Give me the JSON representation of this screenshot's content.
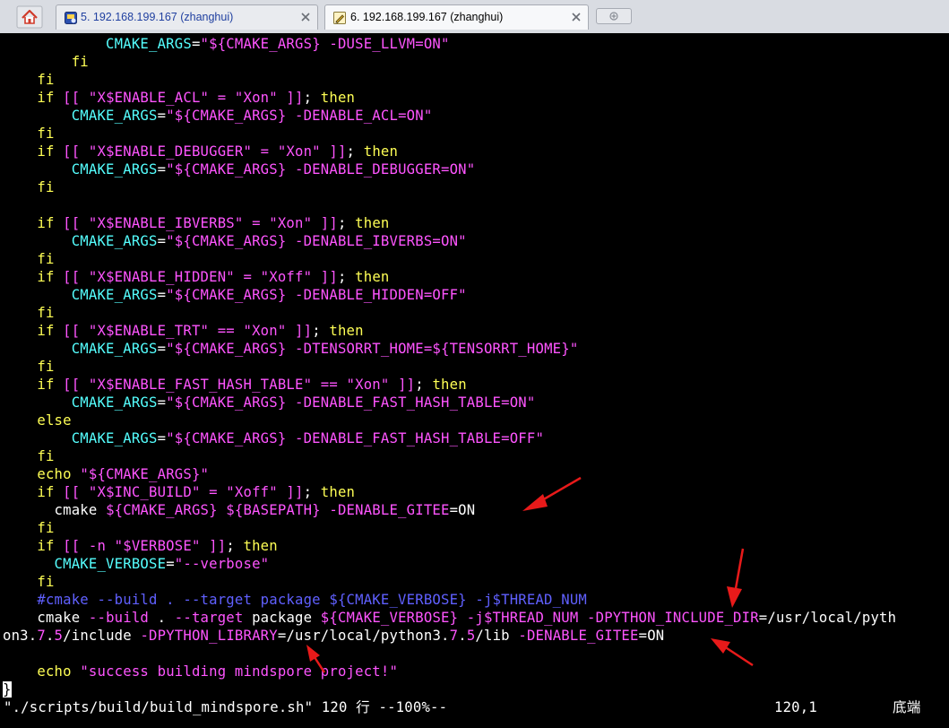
{
  "tabs": [
    {
      "label": "5. 192.168.199.167 (zhanghui)",
      "active": false,
      "icon": "session-icon"
    },
    {
      "label": "6. 192.168.199.167 (zhanghui)",
      "active": true,
      "icon": "pencil-icon"
    }
  ],
  "terminal": {
    "lines": [
      [
        [
          "c",
          "            CMAKE_ARGS"
        ],
        [
          "w",
          "="
        ],
        [
          "s",
          "\"${CMAKE_ARGS} -DUSE_LLVM=ON\""
        ]
      ],
      [
        [
          "k",
          "        fi"
        ]
      ],
      [
        [
          "k",
          "    fi"
        ]
      ],
      [
        [
          "k",
          "    if"
        ],
        [
          "w",
          " "
        ],
        [
          "s",
          "[[ \"X$ENABLE_ACL\" = \"Xon\" ]]"
        ],
        [
          "w",
          "; "
        ],
        [
          "k",
          "then"
        ]
      ],
      [
        [
          "c",
          "        CMAKE_ARGS"
        ],
        [
          "w",
          "="
        ],
        [
          "s",
          "\"${CMAKE_ARGS} -DENABLE_ACL=ON\""
        ]
      ],
      [
        [
          "k",
          "    fi"
        ]
      ],
      [
        [
          "k",
          "    if"
        ],
        [
          "w",
          " "
        ],
        [
          "s",
          "[[ \"X$ENABLE_DEBUGGER\" = \"Xon\" ]]"
        ],
        [
          "w",
          "; "
        ],
        [
          "k",
          "then"
        ]
      ],
      [
        [
          "c",
          "        CMAKE_ARGS"
        ],
        [
          "w",
          "="
        ],
        [
          "s",
          "\"${CMAKE_ARGS} -DENABLE_DEBUGGER=ON\""
        ]
      ],
      [
        [
          "k",
          "    fi"
        ]
      ],
      [],
      [
        [
          "k",
          "    if"
        ],
        [
          "w",
          " "
        ],
        [
          "s",
          "[[ \"X$ENABLE_IBVERBS\" = \"Xon\" ]]"
        ],
        [
          "w",
          "; "
        ],
        [
          "k",
          "then"
        ]
      ],
      [
        [
          "c",
          "        CMAKE_ARGS"
        ],
        [
          "w",
          "="
        ],
        [
          "s",
          "\"${CMAKE_ARGS} -DENABLE_IBVERBS=ON\""
        ]
      ],
      [
        [
          "k",
          "    fi"
        ]
      ],
      [
        [
          "k",
          "    if"
        ],
        [
          "w",
          " "
        ],
        [
          "s",
          "[[ \"X$ENABLE_HIDDEN\" = \"Xoff\" ]]"
        ],
        [
          "w",
          "; "
        ],
        [
          "k",
          "then"
        ]
      ],
      [
        [
          "c",
          "        CMAKE_ARGS"
        ],
        [
          "w",
          "="
        ],
        [
          "s",
          "\"${CMAKE_ARGS} -DENABLE_HIDDEN=OFF\""
        ]
      ],
      [
        [
          "k",
          "    fi"
        ]
      ],
      [
        [
          "k",
          "    if"
        ],
        [
          "w",
          " "
        ],
        [
          "s",
          "[[ \"X$ENABLE_TRT\" == \"Xon\" ]]"
        ],
        [
          "w",
          "; "
        ],
        [
          "k",
          "then"
        ]
      ],
      [
        [
          "c",
          "        CMAKE_ARGS"
        ],
        [
          "w",
          "="
        ],
        [
          "s",
          "\"${CMAKE_ARGS} -DTENSORRT_HOME=${TENSORRT_HOME}\""
        ]
      ],
      [
        [
          "k",
          "    fi"
        ]
      ],
      [
        [
          "k",
          "    if"
        ],
        [
          "w",
          " "
        ],
        [
          "s",
          "[[ \"X$ENABLE_FAST_HASH_TABLE\" == \"Xon\" ]]"
        ],
        [
          "w",
          "; "
        ],
        [
          "k",
          "then"
        ]
      ],
      [
        [
          "c",
          "        CMAKE_ARGS"
        ],
        [
          "w",
          "="
        ],
        [
          "s",
          "\"${CMAKE_ARGS} -DENABLE_FAST_HASH_TABLE=ON\""
        ]
      ],
      [
        [
          "k",
          "    else"
        ]
      ],
      [
        [
          "c",
          "        CMAKE_ARGS"
        ],
        [
          "w",
          "="
        ],
        [
          "s",
          "\"${CMAKE_ARGS} -DENABLE_FAST_HASH_TABLE=OFF\""
        ]
      ],
      [
        [
          "k",
          "    fi"
        ]
      ],
      [
        [
          "k",
          "    echo"
        ],
        [
          "w",
          " "
        ],
        [
          "s",
          "\"${CMAKE_ARGS}\""
        ]
      ],
      [
        [
          "k",
          "    if"
        ],
        [
          "w",
          " "
        ],
        [
          "s",
          "[[ \"X$INC_BUILD\" = \"Xoff\" ]]"
        ],
        [
          "w",
          "; "
        ],
        [
          "k",
          "then"
        ]
      ],
      [
        [
          "w",
          "      cmake "
        ],
        [
          "s",
          "${CMAKE_ARGS} ${BASEPATH} -DENABLE_GITEE"
        ],
        [
          "w",
          "=ON"
        ]
      ],
      [
        [
          "k",
          "    fi"
        ]
      ],
      [
        [
          "k",
          "    if"
        ],
        [
          "w",
          " "
        ],
        [
          "s",
          "[[ -n \"$VERBOSE\" ]]"
        ],
        [
          "w",
          "; "
        ],
        [
          "k",
          "then"
        ]
      ],
      [
        [
          "c",
          "      CMAKE_VERBOSE"
        ],
        [
          "w",
          "="
        ],
        [
          "s",
          "\"--verbose\""
        ]
      ],
      [
        [
          "k",
          "    fi"
        ]
      ],
      [
        [
          "b",
          "    #cmake --build . --target package ${CMAKE_VERBOSE} -j$THREAD_NUM"
        ]
      ],
      [
        [
          "w",
          "    cmake "
        ],
        [
          "s",
          "--build"
        ],
        [
          "w",
          " . "
        ],
        [
          "s",
          "--target"
        ],
        [
          "w",
          " package "
        ],
        [
          "s",
          "${CMAKE_VERBOSE} -j$THREAD_NUM -DPYTHON_INCLUDE_DIR"
        ],
        [
          "w",
          "=/usr/local/pyth"
        ]
      ],
      [
        [
          "w",
          "on3."
        ],
        [
          "s",
          "7"
        ],
        [
          "w",
          "."
        ],
        [
          "s",
          "5"
        ],
        [
          "w",
          "/include "
        ],
        [
          "s",
          "-DPYTHON_LIBRARY"
        ],
        [
          "w",
          "=/usr/local/python3."
        ],
        [
          "s",
          "7"
        ],
        [
          "w",
          "."
        ],
        [
          "s",
          "5"
        ],
        [
          "w",
          "/lib "
        ],
        [
          "s",
          "-DENABLE_GITEE"
        ],
        [
          "w",
          "=ON"
        ]
      ],
      [],
      [
        [
          "k",
          "    echo"
        ],
        [
          "w",
          " "
        ],
        [
          "s",
          "\"success building mindspore project!\""
        ]
      ],
      [
        [
          "cur",
          "}"
        ]
      ]
    ],
    "status_left": "\"./scripts/build/build_mindspore.sh\" 120 行 --100%--",
    "status_pos": "120,1",
    "status_end": "底端"
  }
}
